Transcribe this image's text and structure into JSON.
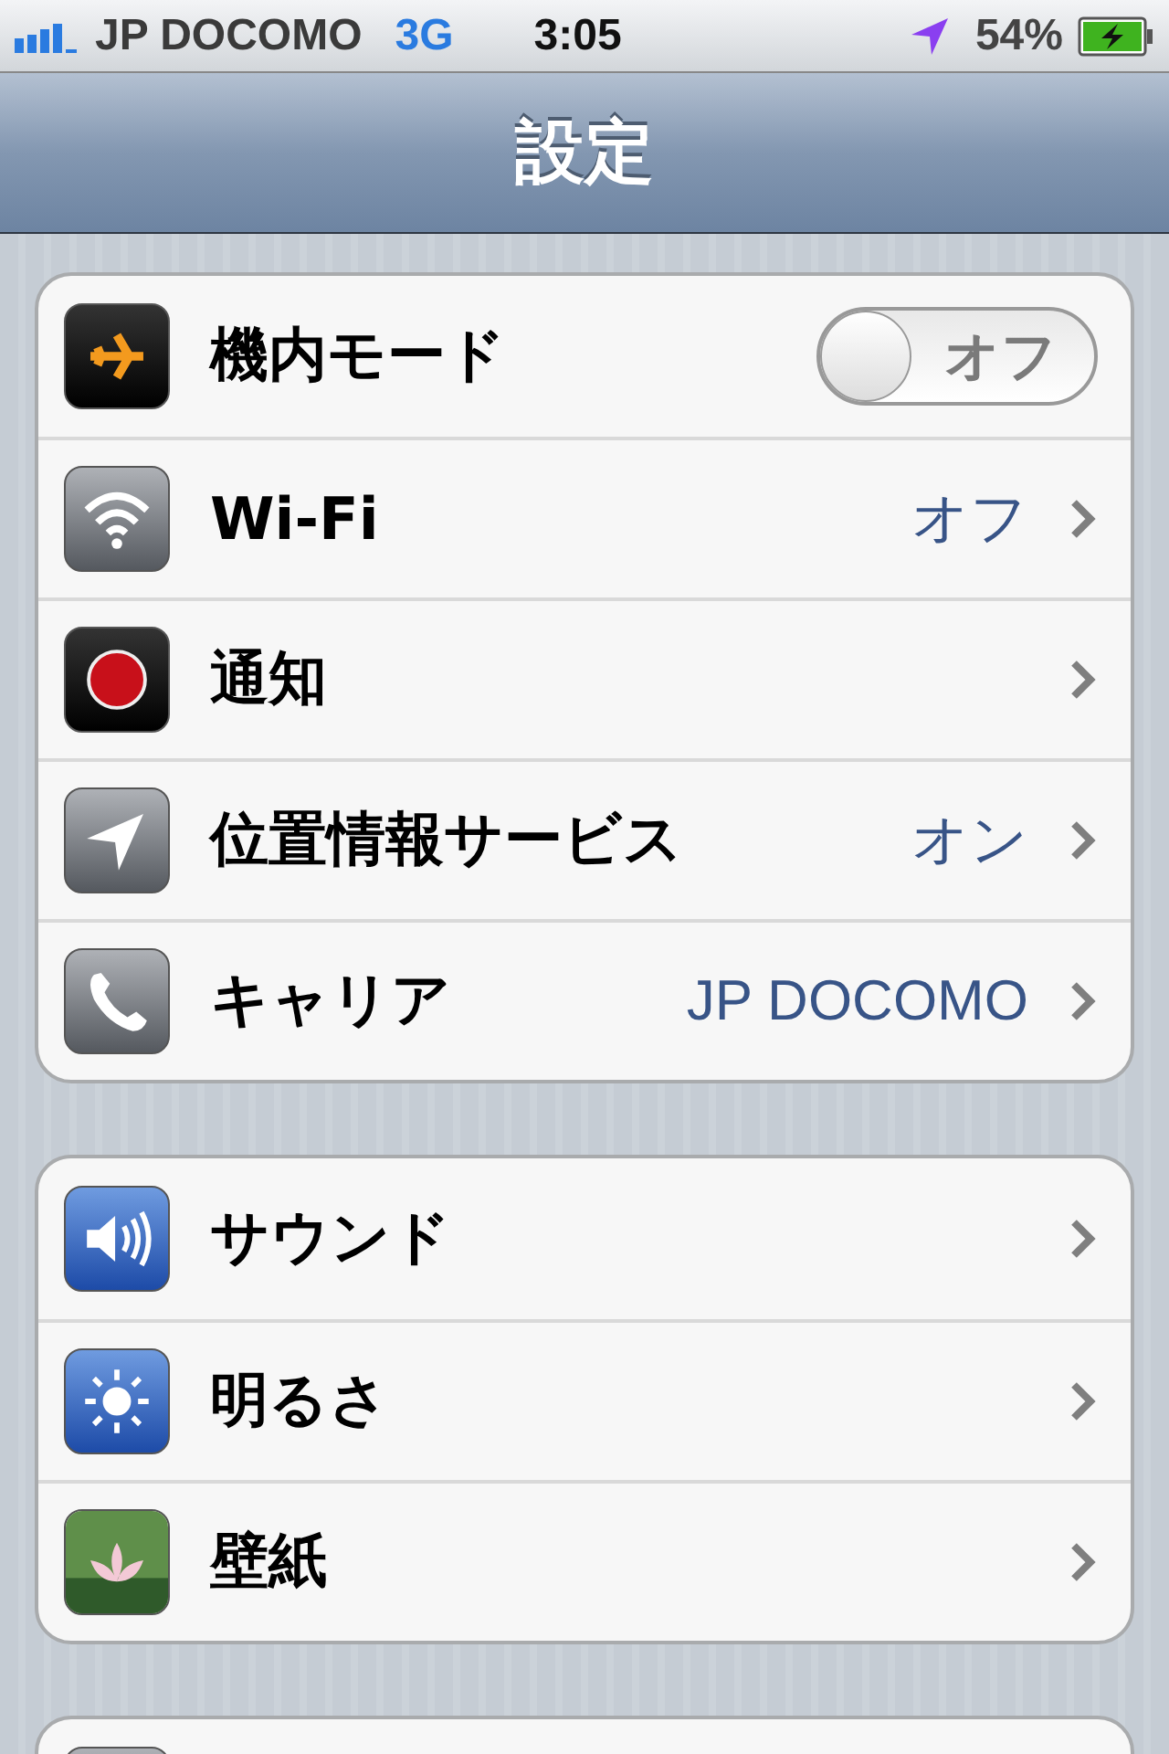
{
  "status_bar": {
    "carrier": "JP DOCOMO",
    "network": "3G",
    "time": "3:05",
    "battery_percent": "54%"
  },
  "nav_bar": {
    "title": "設定"
  },
  "groups": [
    {
      "rows": [
        {
          "kind": "toggle",
          "label": "機内モード",
          "on": false,
          "toggle_text": "オフ"
        },
        {
          "kind": "link",
          "label": "Wi-Fi",
          "value": "オフ"
        },
        {
          "kind": "link",
          "label": "通知"
        },
        {
          "kind": "link",
          "label": "位置情報サービス",
          "value": "オン"
        },
        {
          "kind": "link",
          "label": "キャリア",
          "value": "JP DOCOMO"
        }
      ]
    },
    {
      "rows": [
        {
          "kind": "link",
          "label": "サウンド"
        },
        {
          "kind": "link",
          "label": "明るさ"
        },
        {
          "kind": "link",
          "label": "壁紙"
        }
      ]
    },
    {
      "partial": true
    }
  ]
}
